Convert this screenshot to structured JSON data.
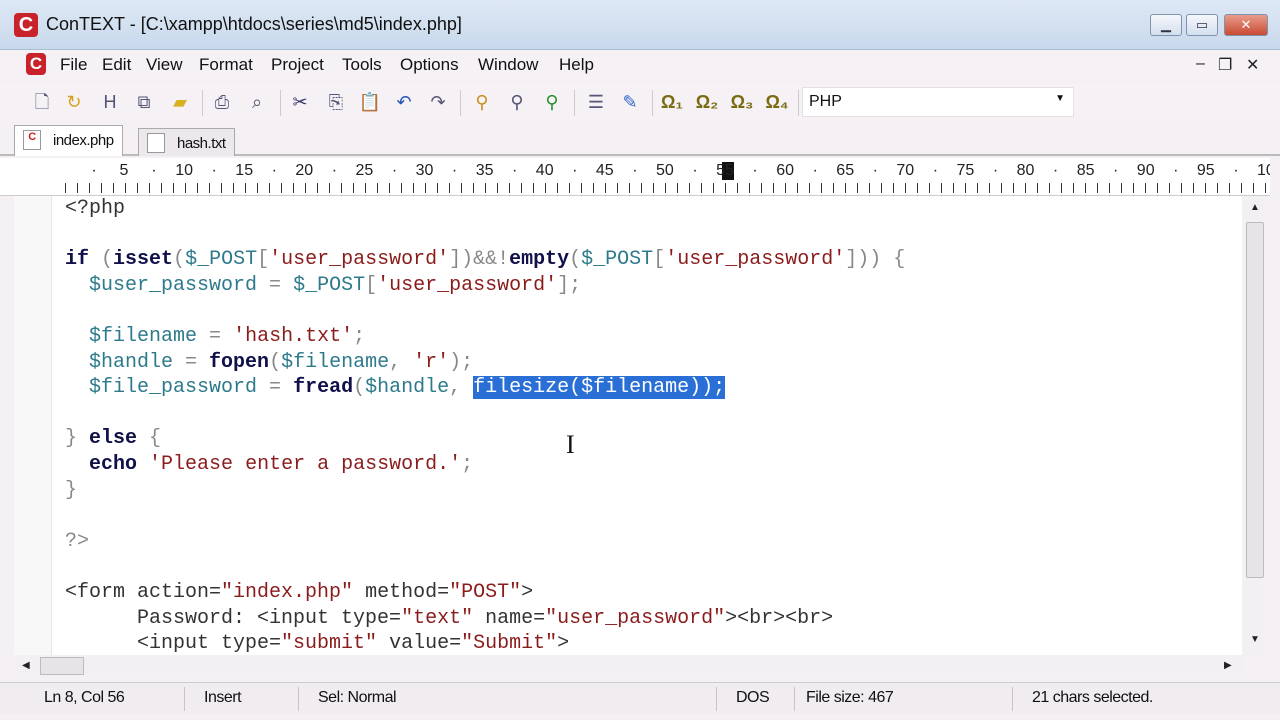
{
  "window": {
    "title": "ConTEXT - [C:\\xampp\\htdocs\\series\\md5\\index.php]",
    "app_icon": "C",
    "controls": [
      "minimize",
      "restore",
      "close"
    ]
  },
  "menu": [
    "File",
    "Edit",
    "View",
    "Format",
    "Project",
    "Tools",
    "Options",
    "Window",
    "Help"
  ],
  "toolbar": {
    "icons": [
      "new-file",
      "open",
      "save",
      "save-all",
      "open-folder",
      "print",
      "print-preview",
      "cut",
      "copy",
      "paste",
      "undo",
      "redo",
      "find",
      "find-next",
      "replace",
      "document-properties",
      "settings",
      "user-command-1",
      "user-command-2",
      "user-command-3",
      "user-command-4"
    ],
    "language": "PHP"
  },
  "tabs": [
    {
      "label": "index.php",
      "active": true
    },
    {
      "label": "hash.txt",
      "active": false
    }
  ],
  "ruler": [
    "5",
    "10",
    "15",
    "20",
    "25",
    "30",
    "35",
    "40",
    "45",
    "50",
    "55",
    "60",
    "65",
    "70",
    "75",
    "80",
    "85",
    "90",
    "95",
    "10"
  ],
  "code": [
    [
      [
        "tag",
        "<?php"
      ]
    ],
    [],
    [
      [
        "kw",
        "if"
      ],
      [
        "pn",
        " ("
      ],
      [
        "kw",
        "isset"
      ],
      [
        "pn",
        "("
      ],
      [
        "var",
        "$_POST"
      ],
      [
        "pn",
        "["
      ],
      [
        "str",
        "'user_password'"
      ],
      [
        "pn",
        "])&&!"
      ],
      [
        "kw",
        "empty"
      ],
      [
        "pn",
        "("
      ],
      [
        "var",
        "$_POST"
      ],
      [
        "pn",
        "["
      ],
      [
        "str",
        "'user_password'"
      ],
      [
        "pn",
        "])) {"
      ]
    ],
    [
      [
        "pn",
        "  "
      ],
      [
        "var",
        "$user_password"
      ],
      [
        "pn",
        " = "
      ],
      [
        "var",
        "$_POST"
      ],
      [
        "pn",
        "["
      ],
      [
        "str",
        "'user_password'"
      ],
      [
        "pn",
        "];"
      ]
    ],
    [],
    [
      [
        "pn",
        "  "
      ],
      [
        "var",
        "$filename"
      ],
      [
        "pn",
        " = "
      ],
      [
        "str",
        "'hash.txt'"
      ],
      [
        "pn",
        ";"
      ]
    ],
    [
      [
        "pn",
        "  "
      ],
      [
        "var",
        "$handle"
      ],
      [
        "pn",
        " = "
      ],
      [
        "kw",
        "fopen"
      ],
      [
        "pn",
        "("
      ],
      [
        "var",
        "$filename"
      ],
      [
        "pn",
        ", "
      ],
      [
        "str",
        "'r'"
      ],
      [
        "pn",
        ");"
      ]
    ],
    [
      [
        "pn",
        "  "
      ],
      [
        "var",
        "$file_password"
      ],
      [
        "pn",
        " = "
      ],
      [
        "kw",
        "fread"
      ],
      [
        "pn",
        "("
      ],
      [
        "var",
        "$handle"
      ],
      [
        "pn",
        ", "
      ],
      [
        "sel",
        "filesize($filename));"
      ]
    ],
    [],
    [
      [
        "pn",
        "} "
      ],
      [
        "kw",
        "else"
      ],
      [
        "pn",
        " {"
      ]
    ],
    [
      [
        "pn",
        "  "
      ],
      [
        "kw",
        "echo"
      ],
      [
        "pn",
        " "
      ],
      [
        "str",
        "'Please enter a password.'"
      ],
      [
        "pn",
        ";"
      ]
    ],
    [
      [
        "pn",
        "}"
      ]
    ],
    [],
    [
      [
        "pn",
        "?>"
      ]
    ],
    [],
    [
      [
        "tag",
        "<form "
      ],
      [
        "tag",
        "action="
      ],
      [
        "str",
        "\"index.php\""
      ],
      [
        "tag",
        " method="
      ],
      [
        "str",
        "\"POST\""
      ],
      [
        "tag",
        ">"
      ]
    ],
    [
      [
        "tag",
        "      Password: <input type="
      ],
      [
        "str",
        "\"text\""
      ],
      [
        "tag",
        " name="
      ],
      [
        "str",
        "\"user_password\""
      ],
      [
        "tag",
        "><br><br>"
      ]
    ],
    [
      [
        "tag",
        "      <input type="
      ],
      [
        "str",
        "\"submit\""
      ],
      [
        "tag",
        " value="
      ],
      [
        "str",
        "\"Submit\""
      ],
      [
        "tag",
        ">"
      ]
    ]
  ],
  "status": {
    "position": "Ln 8, Col 56",
    "mode": "Insert",
    "sel_mode": "Sel: Normal",
    "format": "DOS",
    "file_size": "File size: 467",
    "selection": "21 chars selected."
  }
}
